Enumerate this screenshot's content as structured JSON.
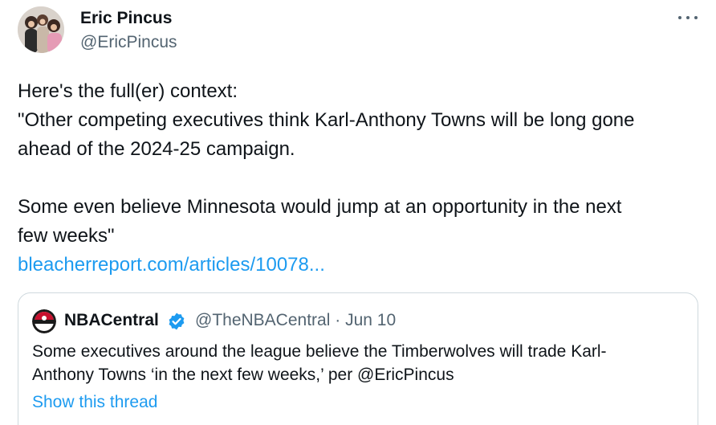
{
  "author": {
    "name": "Eric Pincus",
    "handle": "@EricPincus",
    "avatar_icon": "profile-photo"
  },
  "more_icon": "ellipsis-horizontal-icon",
  "tweet": {
    "lines": [
      "Here's the full(er) context:",
      "\"Other competing executives think Karl-Anthony Towns will be long gone",
      "ahead of the 2024-25 campaign.",
      "Some even believe Minnesota would jump at an opportunity in the next",
      "few weeks\""
    ],
    "link_text": "bleacherreport.com/articles/10078..."
  },
  "quote": {
    "name": "NBACentral",
    "verified_icon": "verified-badge-icon",
    "handle": "@TheNBACentral",
    "separator": "·",
    "date": "Jun 10",
    "text_lines": [
      "Some executives around the league believe the Timberwolves will trade Karl-",
      "Anthony Towns ‘in the next few weeks,’ per @EricPincus"
    ],
    "show_thread": "Show this thread"
  },
  "colors": {
    "link": "#1d9bf0",
    "secondary_text": "#536471",
    "border": "#cfd9de"
  }
}
